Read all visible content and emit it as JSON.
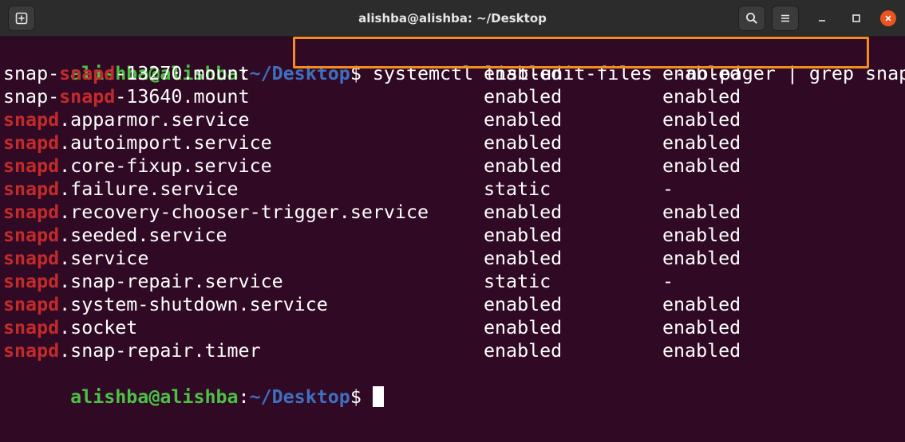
{
  "window": {
    "title": "alishba@alishba: ~/Desktop"
  },
  "colors": {
    "background": "#300a24",
    "prompt_user": "#4bc245",
    "prompt_path": "#3f6fc0",
    "grep_match": "#c32b2b",
    "highlight_box": "#f28c1e"
  },
  "icons": {
    "new_tab": "new-tab-icon",
    "search": "search-icon",
    "menu": "hamburger-menu-icon",
    "minimize": "minimize-icon",
    "maximize": "maximize-icon",
    "close": "close-icon"
  },
  "prompt": {
    "user_host": "alishba@alishba",
    "colon": ":",
    "path": "~/Desktop",
    "symbol": "$ "
  },
  "command": "systemctl list-unit-files --no-pager | grep snapd",
  "rows": [
    {
      "pre": "snap-",
      "match": "snapd",
      "post": "-13270.mount",
      "state": "enabled",
      "preset": "enabled"
    },
    {
      "pre": "snap-",
      "match": "snapd",
      "post": "-13640.mount",
      "state": "enabled",
      "preset": "enabled"
    },
    {
      "pre": "",
      "match": "snapd",
      "post": ".apparmor.service",
      "state": "enabled",
      "preset": "enabled"
    },
    {
      "pre": "",
      "match": "snapd",
      "post": ".autoimport.service",
      "state": "enabled",
      "preset": "enabled"
    },
    {
      "pre": "",
      "match": "snapd",
      "post": ".core-fixup.service",
      "state": "enabled",
      "preset": "enabled"
    },
    {
      "pre": "",
      "match": "snapd",
      "post": ".failure.service",
      "state": "static",
      "preset": "-"
    },
    {
      "pre": "",
      "match": "snapd",
      "post": ".recovery-chooser-trigger.service",
      "state": "enabled",
      "preset": "enabled"
    },
    {
      "pre": "",
      "match": "snapd",
      "post": ".seeded.service",
      "state": "enabled",
      "preset": "enabled"
    },
    {
      "pre": "",
      "match": "snapd",
      "post": ".service",
      "state": "enabled",
      "preset": "enabled"
    },
    {
      "pre": "",
      "match": "snapd",
      "post": ".snap-repair.service",
      "state": "static",
      "preset": "-"
    },
    {
      "pre": "",
      "match": "snapd",
      "post": ".system-shutdown.service",
      "state": "enabled",
      "preset": "enabled"
    },
    {
      "pre": "",
      "match": "snapd",
      "post": ".socket",
      "state": "enabled",
      "preset": "enabled"
    },
    {
      "pre": "",
      "match": "snapd",
      "post": ".snap-repair.timer",
      "state": "enabled",
      "preset": "enabled"
    }
  ]
}
